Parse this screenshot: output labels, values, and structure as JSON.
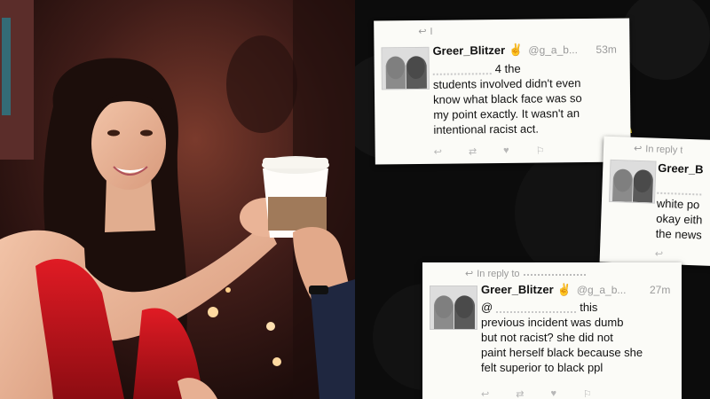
{
  "card1": {
    "reply_prefix": "I",
    "username": "Greer_Blitzer",
    "handle": "@g_a_b...",
    "time": "53m",
    "lines": [
      "4 the",
      "students involved didn't even",
      "know what black face was so",
      "my point exactly. It wasn't an",
      "intentional racist act."
    ]
  },
  "card2": {
    "reply_prefix": "In reply t",
    "username": "Greer_B",
    "lines": [
      "white po",
      "okay eith",
      "the news"
    ]
  },
  "card3": {
    "reply_prefix": "In reply to",
    "username": "Greer_Blitzer",
    "handle": "@g_a_b...",
    "time": "27m",
    "lines": [
      "@",
      "this",
      "previous incident was dumb",
      "but not racist? she did not",
      "paint herself black because she",
      "felt superior to black ppl"
    ]
  },
  "icons": [
    "reply-icon",
    "retweet-icon",
    "like-icon",
    "more-icon",
    "hand-emoji-icon"
  ]
}
